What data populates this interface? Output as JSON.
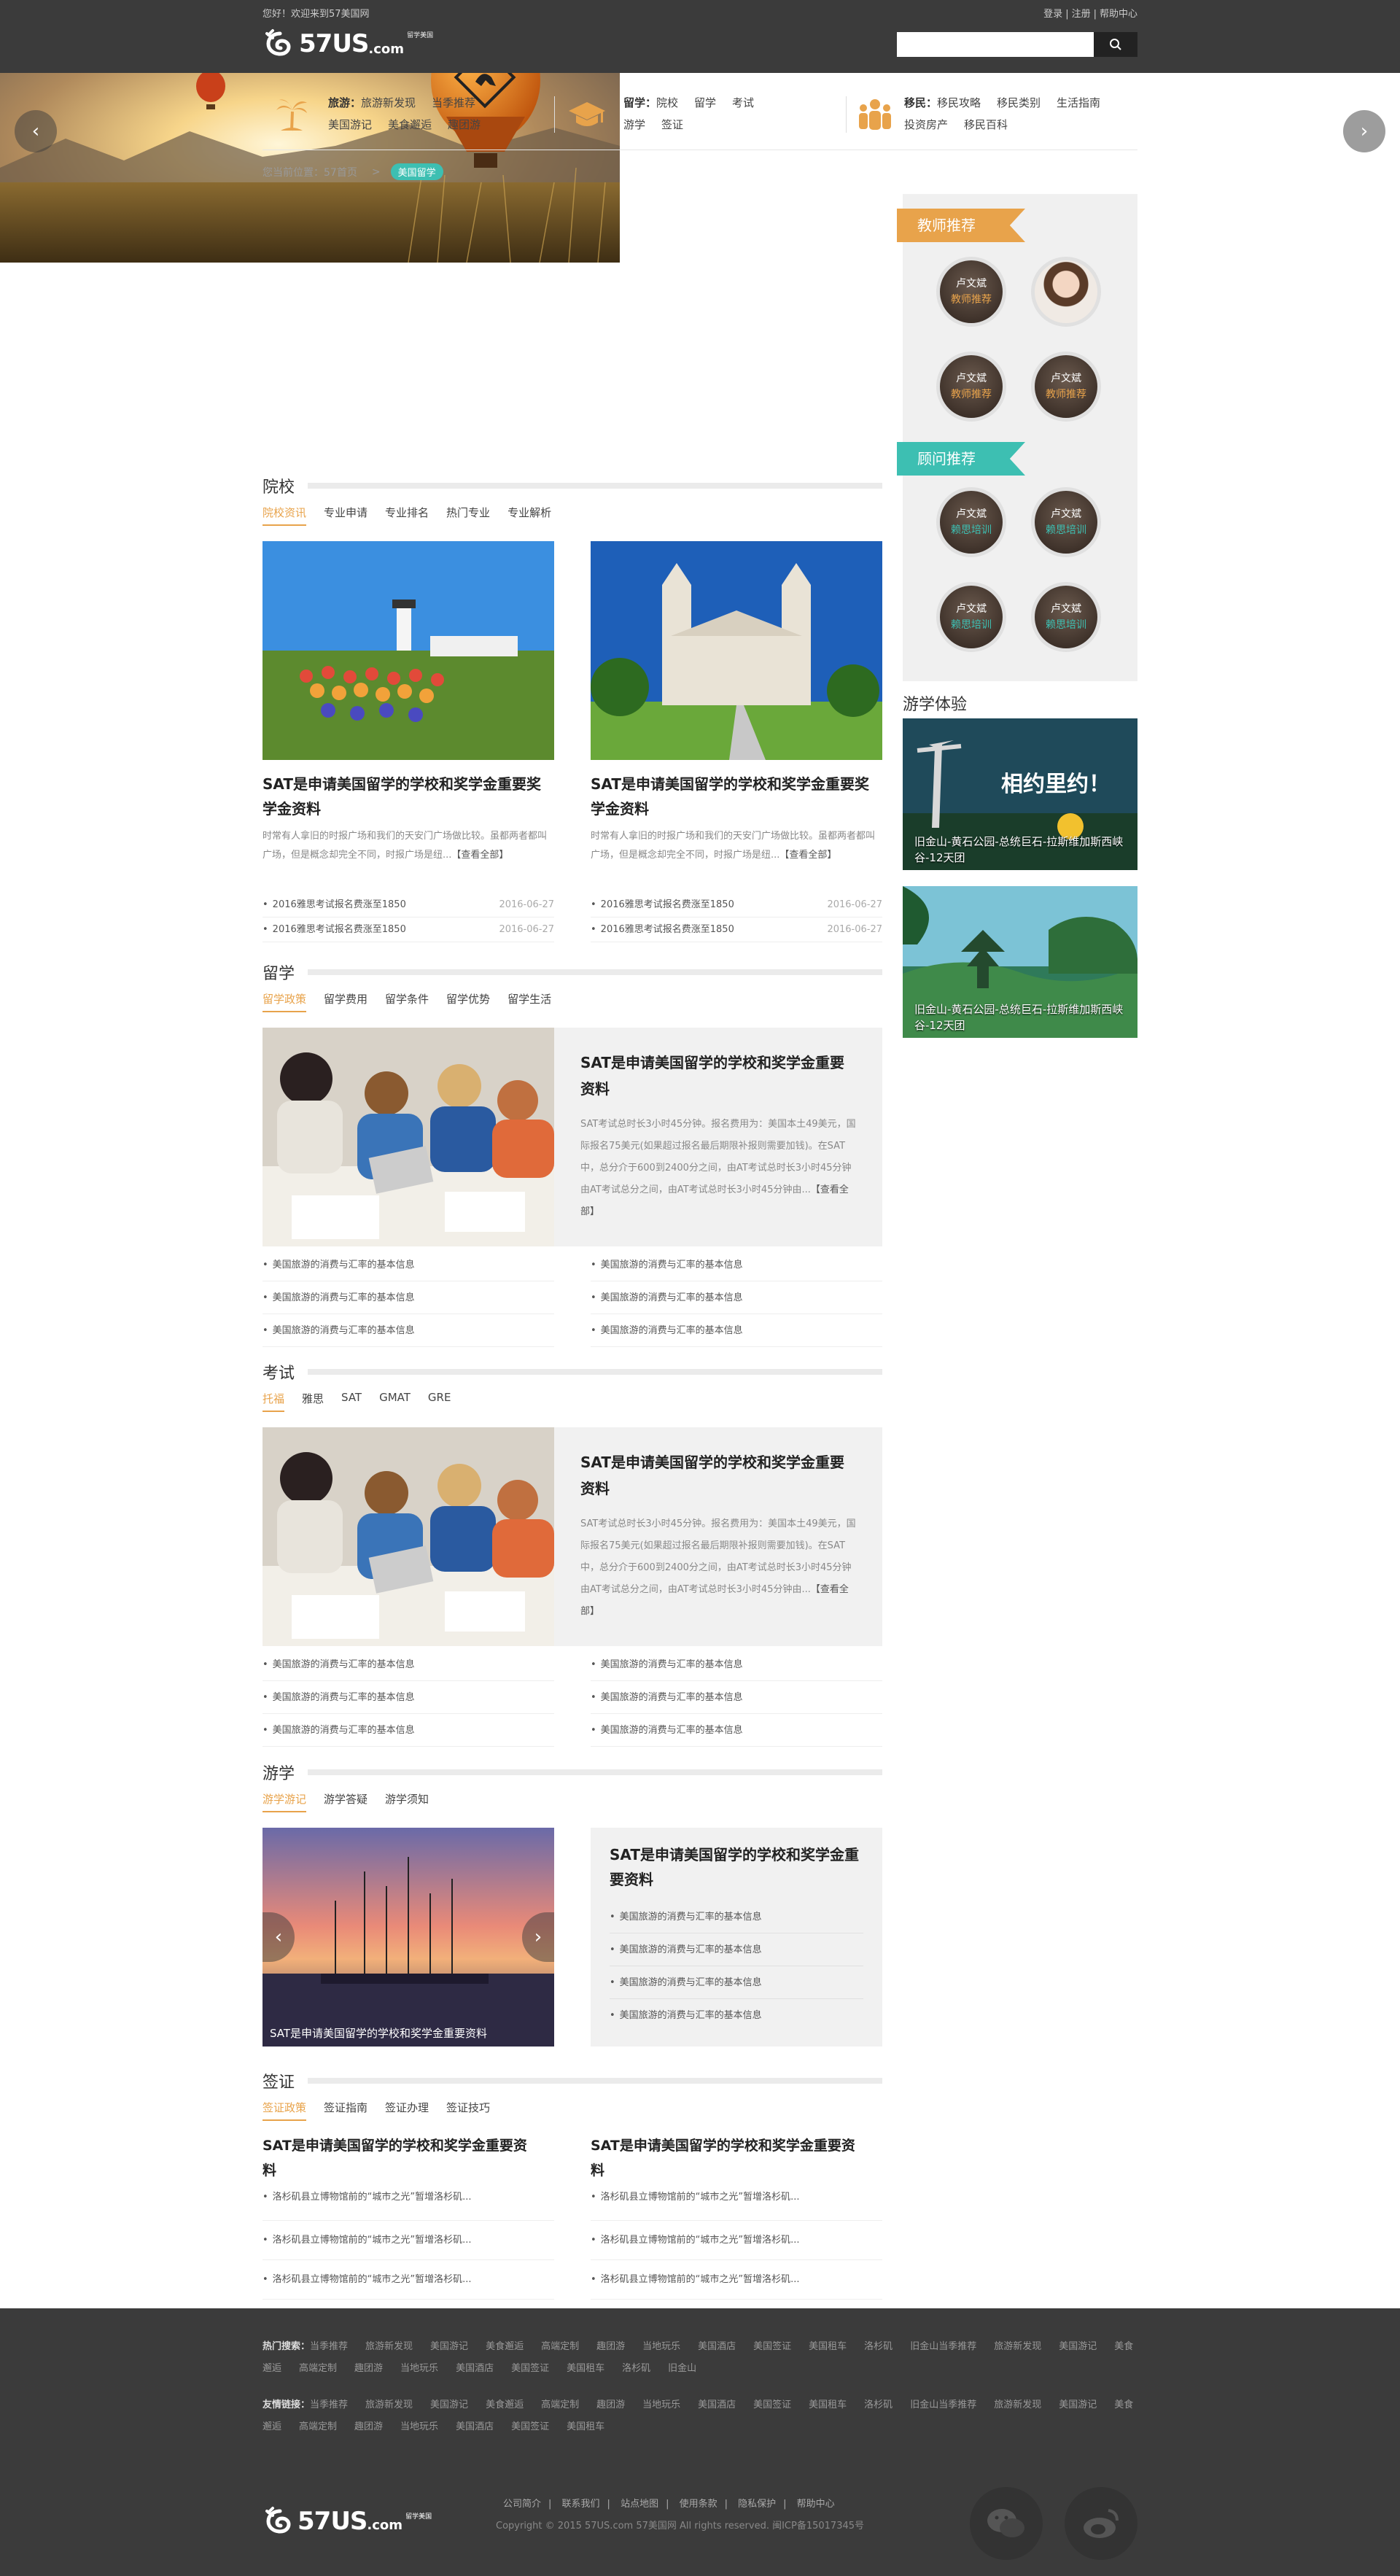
{
  "header": {
    "welcome": "您好！欢迎来到57美国网",
    "links": [
      "登录",
      "注册",
      "帮助中心"
    ],
    "logo_text": "57US",
    "logo_suffix": ".com",
    "logo_small": "留学美国",
    "search_placeholder": ""
  },
  "nav": {
    "travel": {
      "label": "旅游：",
      "items": [
        "旅游新发现",
        "当季推荐",
        "美国游记",
        "美食邂逅",
        "趣团游"
      ]
    },
    "study": {
      "label": "留学：",
      "items": [
        "院校",
        "留学",
        "考试",
        "游学",
        "签证"
      ]
    },
    "immig": {
      "label": "移民：",
      "items": [
        "移民攻略",
        "移民类别",
        "生活指南",
        "投资房产",
        "移民百科"
      ]
    }
  },
  "breadcrumb": {
    "prefix": "您当前位置：57首页",
    "sep": ">",
    "current": "美国留学"
  },
  "sections": {
    "yuanxiao": {
      "title": "院校",
      "tabs": [
        "院校资讯",
        "专业申请",
        "专业排名",
        "热门专业",
        "专业解析"
      ],
      "cards": [
        {
          "title": "SAT是申请美国留学的学校和奖学金重要奖学金资料",
          "desc": "时常有人拿旧的时报广场和我们的天安门广场做比较。虽都两者都叫广场，但是概念却完全不同，时报广场是纽...",
          "more": "【查看全部】",
          "list": [
            {
              "t": "2016雅思考试报名费涨至1850",
              "d": "2016-06-27"
            },
            {
              "t": "2016雅思考试报名费涨至1850",
              "d": "2016-06-27"
            }
          ]
        },
        {
          "title": "SAT是申请美国留学的学校和奖学金重要奖学金资料",
          "desc": "时常有人拿旧的时报广场和我们的天安门广场做比较。虽都两者都叫广场，但是概念却完全不同，时报广场是纽...",
          "more": "【查看全部】",
          "list": [
            {
              "t": "2016雅思考试报名费涨至1850",
              "d": "2016-06-27"
            },
            {
              "t": "2016雅思考试报名费涨至1850",
              "d": "2016-06-27"
            }
          ]
        }
      ]
    },
    "liuxue": {
      "title": "留学",
      "tabs": [
        "留学政策",
        "留学费用",
        "留学条件",
        "留学优势",
        "留学生活"
      ],
      "feature_title": "SAT是申请美国留学的学校和奖学金重要资料",
      "feature_desc": "SAT考试总时长3小时45分钟。报名费用为：美国本土49美元，国际报名75美元(如果超过报名最后期限补报则需要加钱)。在SAT中，总分介于600到2400分之间，由AT考试总时长3小时45分钟由AT考试总分之间，由AT考试总时长3小时45分钟由...",
      "more": "【查看全部】",
      "list_left": [
        "美国旅游的消费与汇率的基本信息",
        "美国旅游的消费与汇率的基本信息",
        "美国旅游的消费与汇率的基本信息"
      ],
      "list_right": [
        "美国旅游的消费与汇率的基本信息",
        "美国旅游的消费与汇率的基本信息",
        "美国旅游的消费与汇率的基本信息"
      ]
    },
    "kaoshi": {
      "title": "考试",
      "tabs": [
        "托福",
        "雅思",
        "SAT",
        "GMAT",
        "GRE"
      ],
      "feature_title": "SAT是申请美国留学的学校和奖学金重要资料",
      "feature_desc": "SAT考试总时长3小时45分钟。报名费用为：美国本土49美元，国际报名75美元(如果超过报名最后期限补报则需要加钱)。在SAT中，总分介于600到2400分之间，由AT考试总时长3小时45分钟由AT考试总分之间，由AT考试总时长3小时45分钟由...",
      "more": "【查看全部】",
      "list_left": [
        "美国旅游的消费与汇率的基本信息",
        "美国旅游的消费与汇率的基本信息",
        "美国旅游的消费与汇率的基本信息"
      ],
      "list_right": [
        "美国旅游的消费与汇率的基本信息",
        "美国旅游的消费与汇率的基本信息",
        "美国旅游的消费与汇率的基本信息"
      ]
    },
    "youxue": {
      "title": "游学",
      "tabs": [
        "游学游记",
        "游学答疑",
        "游学须知"
      ],
      "slide_caption": "SAT是申请美国留学的学校和奖学金重要资料",
      "box_title": "SAT是申请美国留学的学校和奖学金重要资料",
      "list": [
        "美国旅游的消费与汇率的基本信息",
        "美国旅游的消费与汇率的基本信息",
        "美国旅游的消费与汇率的基本信息",
        "美国旅游的消费与汇率的基本信息"
      ]
    },
    "qianzheng": {
      "title": "签证",
      "tabs": [
        "签证政策",
        "签证指南",
        "签证办理",
        "签证技巧"
      ],
      "cols": [
        {
          "title": "SAT是申请美国留学的学校和奖学金重要资料",
          "list": [
            "洛杉矶县立博物馆前的“城市之光”暂增洛杉矶...",
            "洛杉矶县立博物馆前的“城市之光”暂增洛杉矶...",
            "洛杉矶县立博物馆前的“城市之光”暂增洛杉矶..."
          ]
        },
        {
          "title": "SAT是申请美国留学的学校和奖学金重要资料",
          "list": [
            "洛杉矶县立博物馆前的“城市之光”暂增洛杉矶...",
            "洛杉矶县立博物馆前的“城市之光”暂增洛杉矶...",
            "洛杉矶县立博物馆前的“城市之光”暂增洛杉矶..."
          ]
        }
      ]
    }
  },
  "sidebar": {
    "teachers_title": "教师推荐",
    "advisors_title": "顾问推荐",
    "person_name": "卢文斌",
    "teacher_role": "教师推荐",
    "advisor_role": "赖思培训",
    "youxue_title": "游学体验",
    "pic1_banner": "相约里约！",
    "pic1_caption": "旧金山-黄石公园-总统巨石-拉斯维加斯西峡谷-12天团",
    "pic2_caption": "旧金山-黄石公园-总统巨石-拉斯维加斯西峡谷-12天团"
  },
  "footer": {
    "hot_label": "热门搜索：",
    "hot": [
      "当季推荐",
      "旅游新发现",
      "美国游记",
      "美食邂逅",
      "高端定制",
      "趣团游",
      "当地玩乐",
      "美国酒店",
      "美国签证",
      "美国租车",
      "洛杉矶",
      "旧金山当季推荐",
      "旅游新发现",
      "美国游记",
      "美食邂逅",
      "高端定制",
      "趣团游",
      "当地玩乐",
      "美国酒店",
      "美国签证",
      "美国租车",
      "洛杉矶",
      "旧金山"
    ],
    "friend_label": "友情链接：",
    "friend": [
      "当季推荐",
      "旅游新发现",
      "美国游记",
      "美食邂逅",
      "高端定制",
      "趣团游",
      "当地玩乐",
      "美国酒店",
      "美国签证",
      "美国租车",
      "洛杉矶",
      "旧金山当季推荐",
      "旅游新发现",
      "美国游记",
      "美食邂逅",
      "高端定制",
      "趣团游",
      "当地玩乐",
      "美国酒店",
      "美国签证",
      "美国租车"
    ],
    "bottom_links": [
      "公司简介",
      "联系我们",
      "站点地图",
      "使用条款",
      "隐私保护",
      "帮助中心"
    ],
    "copyright": "Copyright © 2015 57US.com 57美国网 All rights reserved. 闽ICP备15017345号"
  },
  "colors": {
    "accent": "#e8a34b",
    "teal": "#3dbfb2",
    "dark": "#3b3b3b"
  }
}
